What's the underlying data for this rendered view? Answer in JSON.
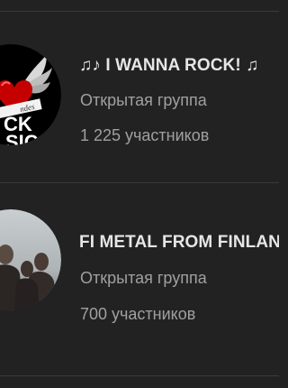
{
  "groups": [
    {
      "title": "♫♪ I WANNA ROCK! ♫",
      "type": "Открытая группа",
      "members": "1 225 участников",
      "avatar_text_top": "CK",
      "avatar_text_bottom": "SIC",
      "avatar_ribbon": "ndes"
    },
    {
      "flag": "FI",
      "title": " METAL FROM FINLAND",
      "type": "Открытая группа",
      "members": "700 участников"
    }
  ],
  "colors": {
    "background": "#222222",
    "title": "#e6e6e6",
    "secondary": "#a0a0a0",
    "divider": "#3a3a3a"
  }
}
